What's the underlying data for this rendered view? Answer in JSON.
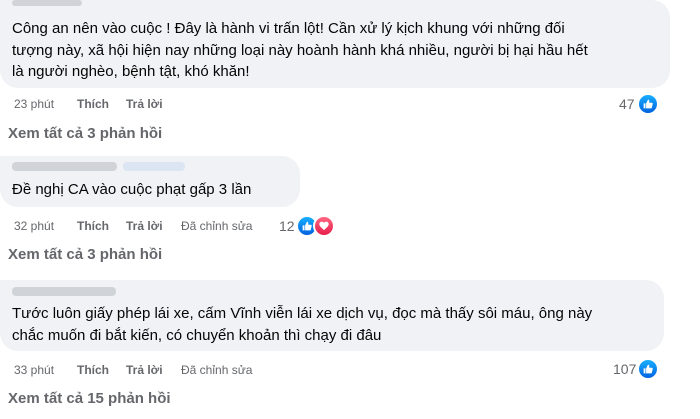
{
  "comments": [
    {
      "text_lines": [
        "Công an nên vào cuộc ! Đây là hành vi trấn lột! Cần xử lý kịch khung với những đối",
        "tượng này, xã hội hiện nay những loại này hoành hành khá nhiều, người bị hại hầu hết",
        "là người nghèo, bệnh tật, khó khăn!"
      ],
      "time": "23 phút",
      "like": "Thích",
      "reply": "Trả lời",
      "reaction_count": "47",
      "reactions": [
        "like-icon"
      ],
      "view_replies": "Xem tất cả 3 phản hồi"
    },
    {
      "text_lines": [
        "Đề nghị CA vào cuộc phạt gấp 3 lần"
      ],
      "time": "32 phút",
      "like": "Thích",
      "reply": "Trả lời",
      "edited": "Đã chỉnh sửa",
      "reaction_count": "12",
      "reactions": [
        "like-icon",
        "love-icon"
      ],
      "view_replies": "Xem tất cả 3 phản hồi"
    },
    {
      "text_lines": [
        "Tước luôn giấy phép lái xe, cấm Vĩnh viễn lái xe dịch vụ, đọc mà thấy sôi máu, ông này",
        "chắc muốn đi bắt kiến, có chuyển khoản thì chạy đi đâu"
      ],
      "time": "33 phút",
      "like": "Thích",
      "reply": "Trả lời",
      "edited": "Đã chỉnh sửa",
      "reaction_count": "107",
      "reactions": [
        "like-icon"
      ],
      "view_replies": "Xem tất cả 15 phản hồi"
    }
  ],
  "colors": {
    "bubble": "#f0f2f5",
    "meta_text": "#65676b",
    "like_blue": "#0866ff",
    "love_red": "#f33e58"
  }
}
